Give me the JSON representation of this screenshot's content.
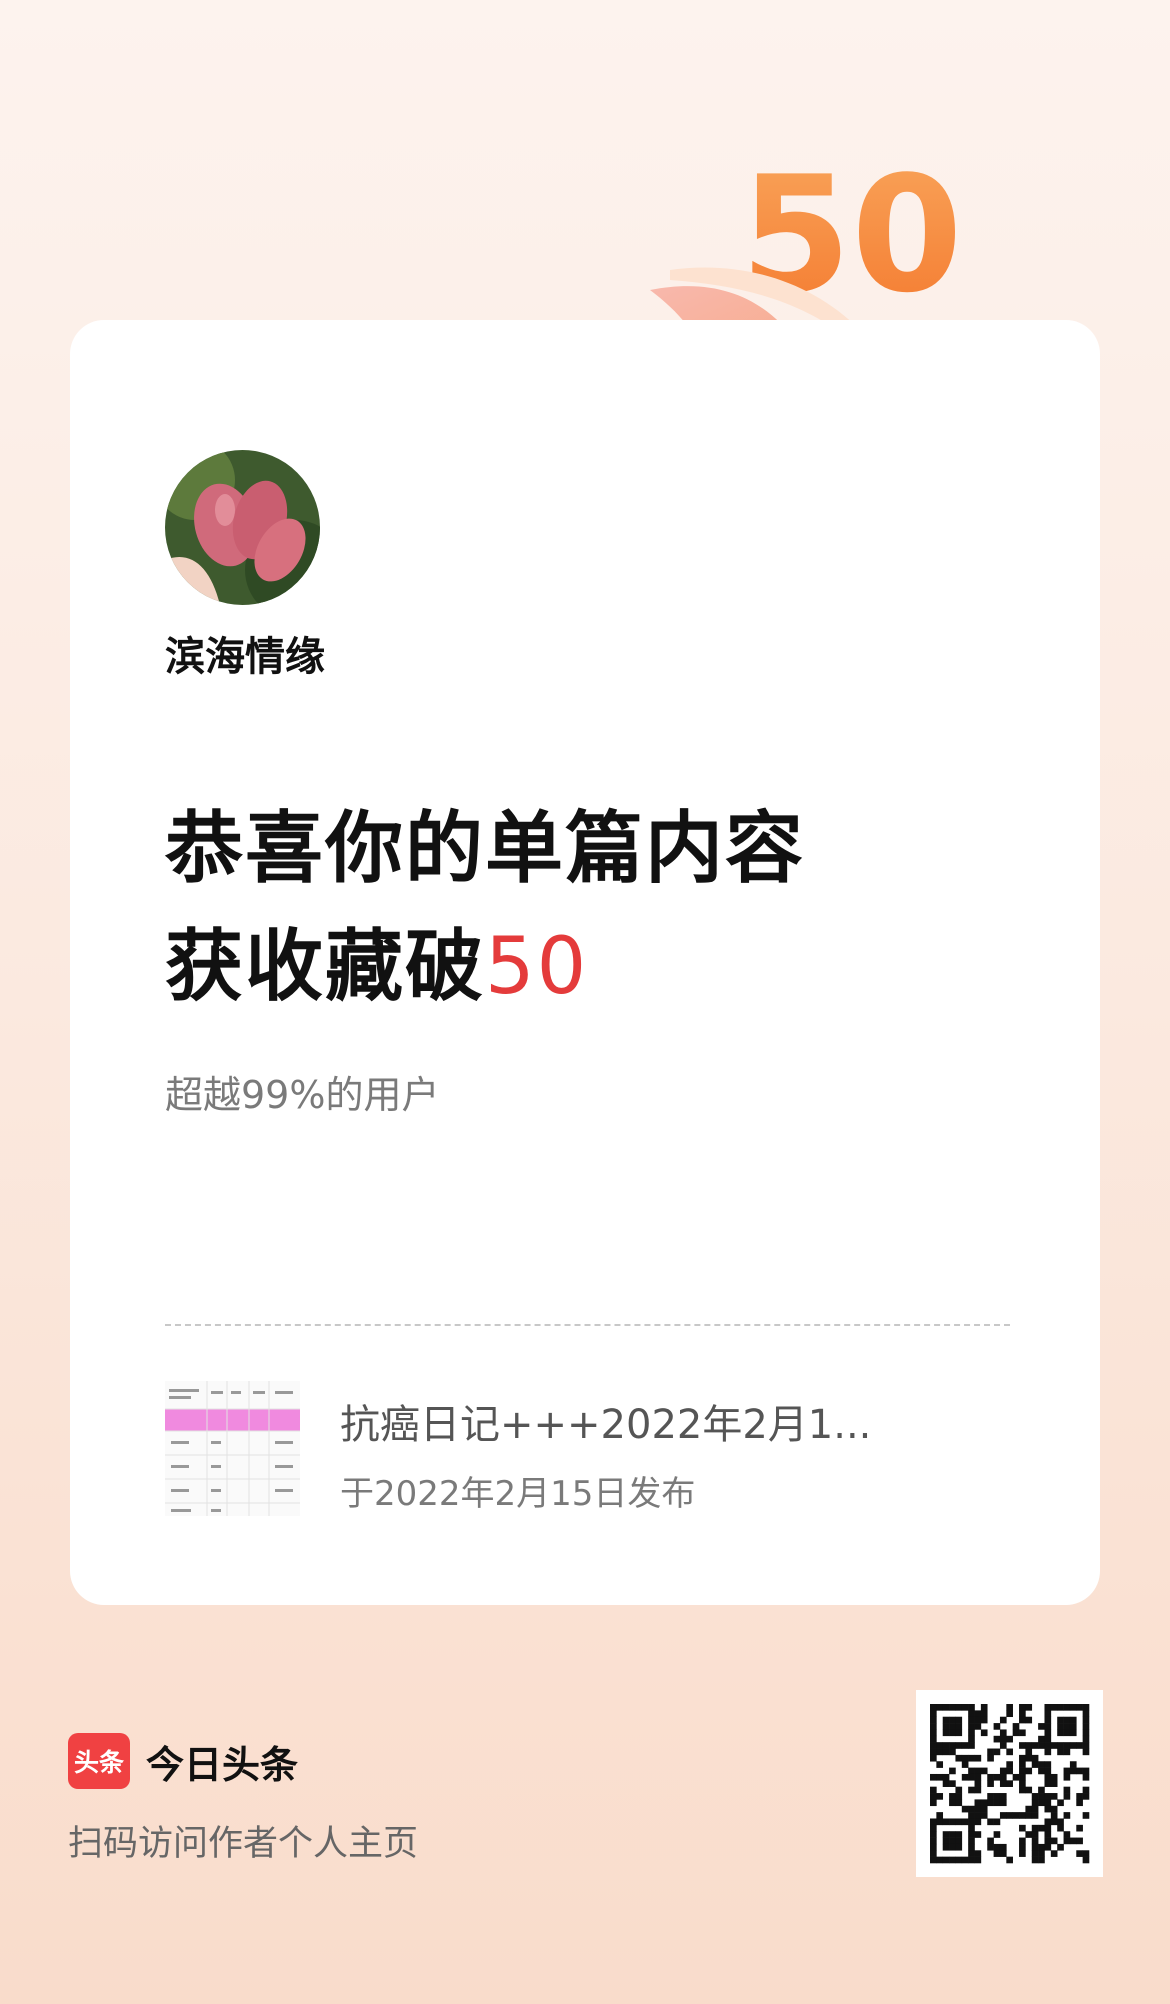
{
  "badge": {
    "number": "50"
  },
  "author": {
    "name": "滨海情缘"
  },
  "headline": {
    "line1": "恭喜你的单篇内容",
    "line2_prefix": "获收藏破",
    "line2_number": "50"
  },
  "subtitle": "超越99%的用户",
  "article": {
    "title": "抗癌日记+++2022年2月1...",
    "published": "于2022年2月15日发布"
  },
  "footer": {
    "logo_text": "头条",
    "app_name": "今日头条",
    "scan_tip": "扫码访问作者个人主页"
  },
  "colors": {
    "accent": "#e43b3b",
    "logo": "#f04142",
    "badge_orange": "#f7923f"
  }
}
